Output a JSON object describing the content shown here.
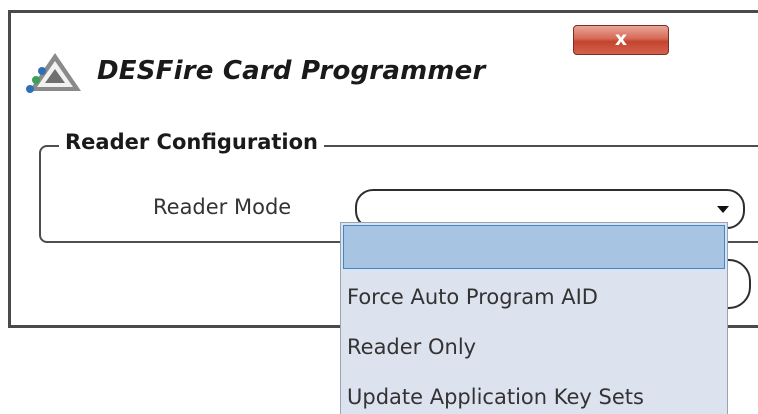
{
  "window": {
    "title": "DESFire Card Programmer",
    "close_glyph": "x",
    "app_icon": "triangle-logo-icon"
  },
  "reader_configuration": {
    "group_title": "Reader Configuration",
    "reader_mode": {
      "label": "Reader Mode",
      "selected_value": "",
      "options": [
        "",
        "Force Auto Program AID",
        "Reader Only",
        "Update Application Key Sets"
      ],
      "highlighted_option_index": 0
    }
  },
  "colors": {
    "dropdown_background": "#dde2ef",
    "highlight_fill": "#a7c4e3",
    "highlight_border": "#3f87c9",
    "close_button_red": "#c2442f"
  }
}
